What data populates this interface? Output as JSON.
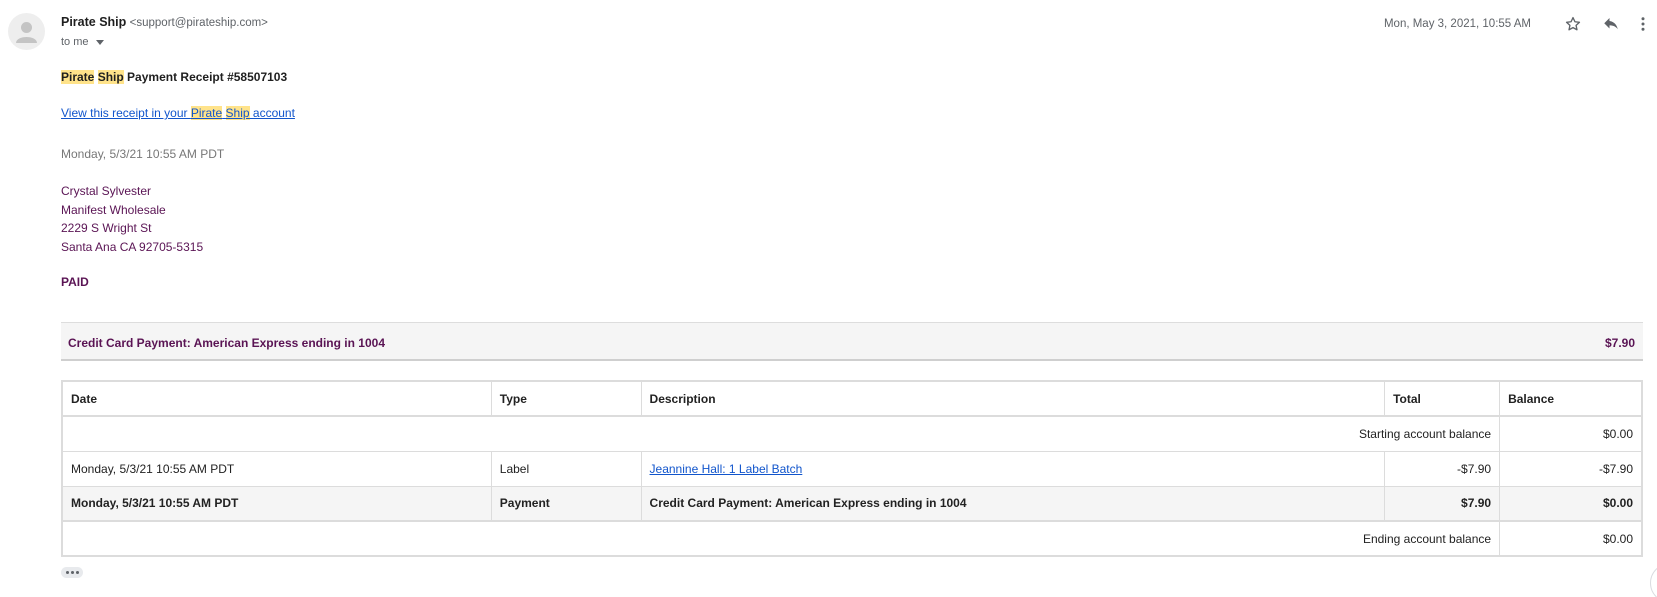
{
  "header": {
    "sender_name": "Pirate Ship",
    "sender_email": "<support@pirateship.com>",
    "to": "to me",
    "date": "Mon, May 3, 2021, 10:55 AM"
  },
  "icons": {
    "avatar": "person-icon",
    "star": "star-icon",
    "reply": "reply-icon",
    "more": "more-vert-icon",
    "expand": "ellipsis-icon"
  },
  "body": {
    "subject_hl_1": "Pirate",
    "subject_hl_2": "Ship",
    "subject_rest": "Payment Receipt #58507103",
    "link_pre": "View this receipt in your ",
    "link_hl_1": "Pirate",
    "link_hl_2": "Ship",
    "link_post": " account",
    "receipt_date": "Monday, 5/3/21 10:55 AM PDT",
    "address": [
      "Crystal Sylvester",
      "Manifest Wholesale",
      "2229 S Wright St",
      "Santa Ana CA 92705-5315"
    ],
    "status": "PAID"
  },
  "payment_summary": {
    "label": "Credit Card Payment: American Express ending in 1004",
    "amount": "$7.90"
  },
  "ledger": {
    "headers": [
      "Date",
      "Type",
      "Description",
      "Total",
      "Balance"
    ],
    "starting_label": "Starting account balance",
    "starting_value": "$0.00",
    "rows": [
      {
        "date": "Monday, 5/3/21 10:55 AM PDT",
        "type": "Label",
        "description": "Jeannine Hall: 1 Label Batch",
        "total": "-$7.90",
        "balance": "-$7.90"
      },
      {
        "date": "Monday, 5/3/21 10:55 AM PDT",
        "type": "Payment",
        "description": "Credit Card Payment: American Express ending in 1004",
        "total": "$7.90",
        "balance": "$0.00"
      }
    ],
    "ending_label": "Ending account balance",
    "ending_value": "$0.00"
  },
  "colors": {
    "accent_purple": "#5a1454",
    "link_blue": "#1155cc",
    "highlight": "#ffe38a"
  }
}
